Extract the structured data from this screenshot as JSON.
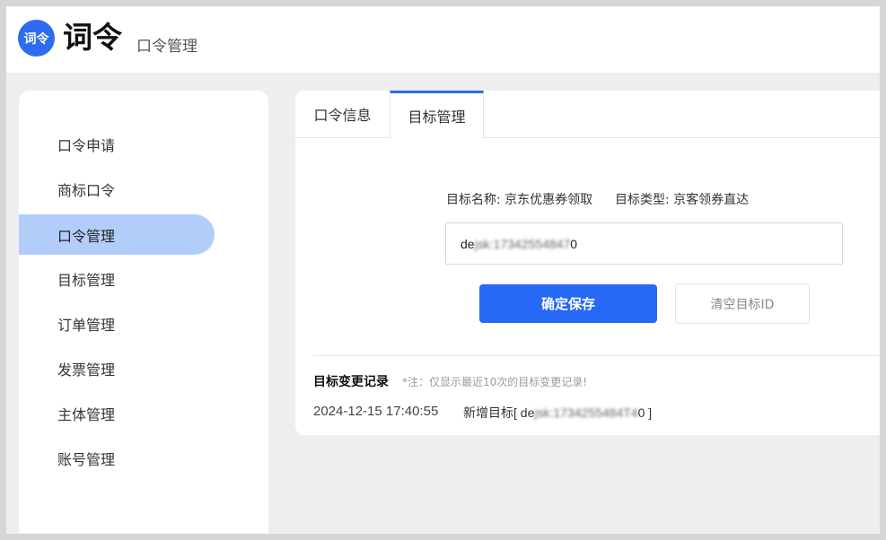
{
  "header": {
    "logo_badge": "词令",
    "logo_text": "词令",
    "subtitle": "口令管理"
  },
  "sidebar": {
    "items": [
      {
        "label": "口令申请"
      },
      {
        "label": "商标口令"
      },
      {
        "label": "口令管理",
        "active": true
      },
      {
        "label": "目标管理"
      },
      {
        "label": "订单管理"
      },
      {
        "label": "发票管理"
      },
      {
        "label": "主体管理"
      },
      {
        "label": "账号管理"
      }
    ]
  },
  "tabs": [
    {
      "label": "口令信息"
    },
    {
      "label": "目标管理",
      "active": true
    }
  ],
  "target": {
    "name_label": "目标名称: 京东优惠券领取",
    "type_label": "目标类型: 京客领券直达",
    "input_prefix": "de",
    "input_blurred": "jsk:17342554847",
    "input_suffix": "0"
  },
  "buttons": {
    "save": "确定保存",
    "clear": "清空目标ID"
  },
  "history": {
    "title": "目标变更记录",
    "note": "*注：仅显示最近10次的目标变更记录!",
    "entries": [
      {
        "time": "2024-12-15 17:40:55",
        "action_prefix": "新增目标[ de",
        "action_blurred": "jsk:1734255484T4",
        "action_suffix": "0 ]"
      }
    ]
  },
  "colors": {
    "accent": "#2569f4",
    "active_nav": "#b3cdfb",
    "background": "#eeeef0"
  }
}
